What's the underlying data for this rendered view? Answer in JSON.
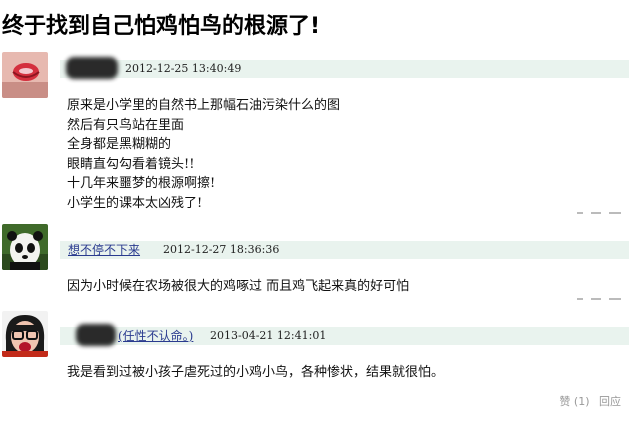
{
  "title": "终于找到自己怕鸡怕鸟的根源了!",
  "posts": [
    {
      "user": "hidden",
      "time": "2012-12-25 13:40:49",
      "lines": [
        "原来是小学里的自然书上那幅石油污染什么的图",
        "然后有只鸟站在里面",
        "全身都是黑糊糊的",
        "眼睛直勾勾看着镜头!!",
        "十几年来噩梦的根源啊擦!",
        "小学生的课本太凶残了!"
      ]
    },
    {
      "user": "想不停不下来",
      "time": "2012-12-27 18:36:36",
      "lines": [
        "因为小时候在农场被很大的鸡啄过 而且鸡飞起来真的好可怕"
      ]
    },
    {
      "user": "(任性不认命。)",
      "time": "2013-04-21 12:41:01",
      "lines": [
        "我是看到过被小孩子虐死过的小鸡小鸟，各种惨状，结果就很怕。"
      ],
      "like_label": "赞 (1)",
      "reply_label": "回应"
    }
  ],
  "colors": {
    "meta_bg": "#e9f3ee",
    "link": "#2a3b8f",
    "muted": "#999999"
  }
}
